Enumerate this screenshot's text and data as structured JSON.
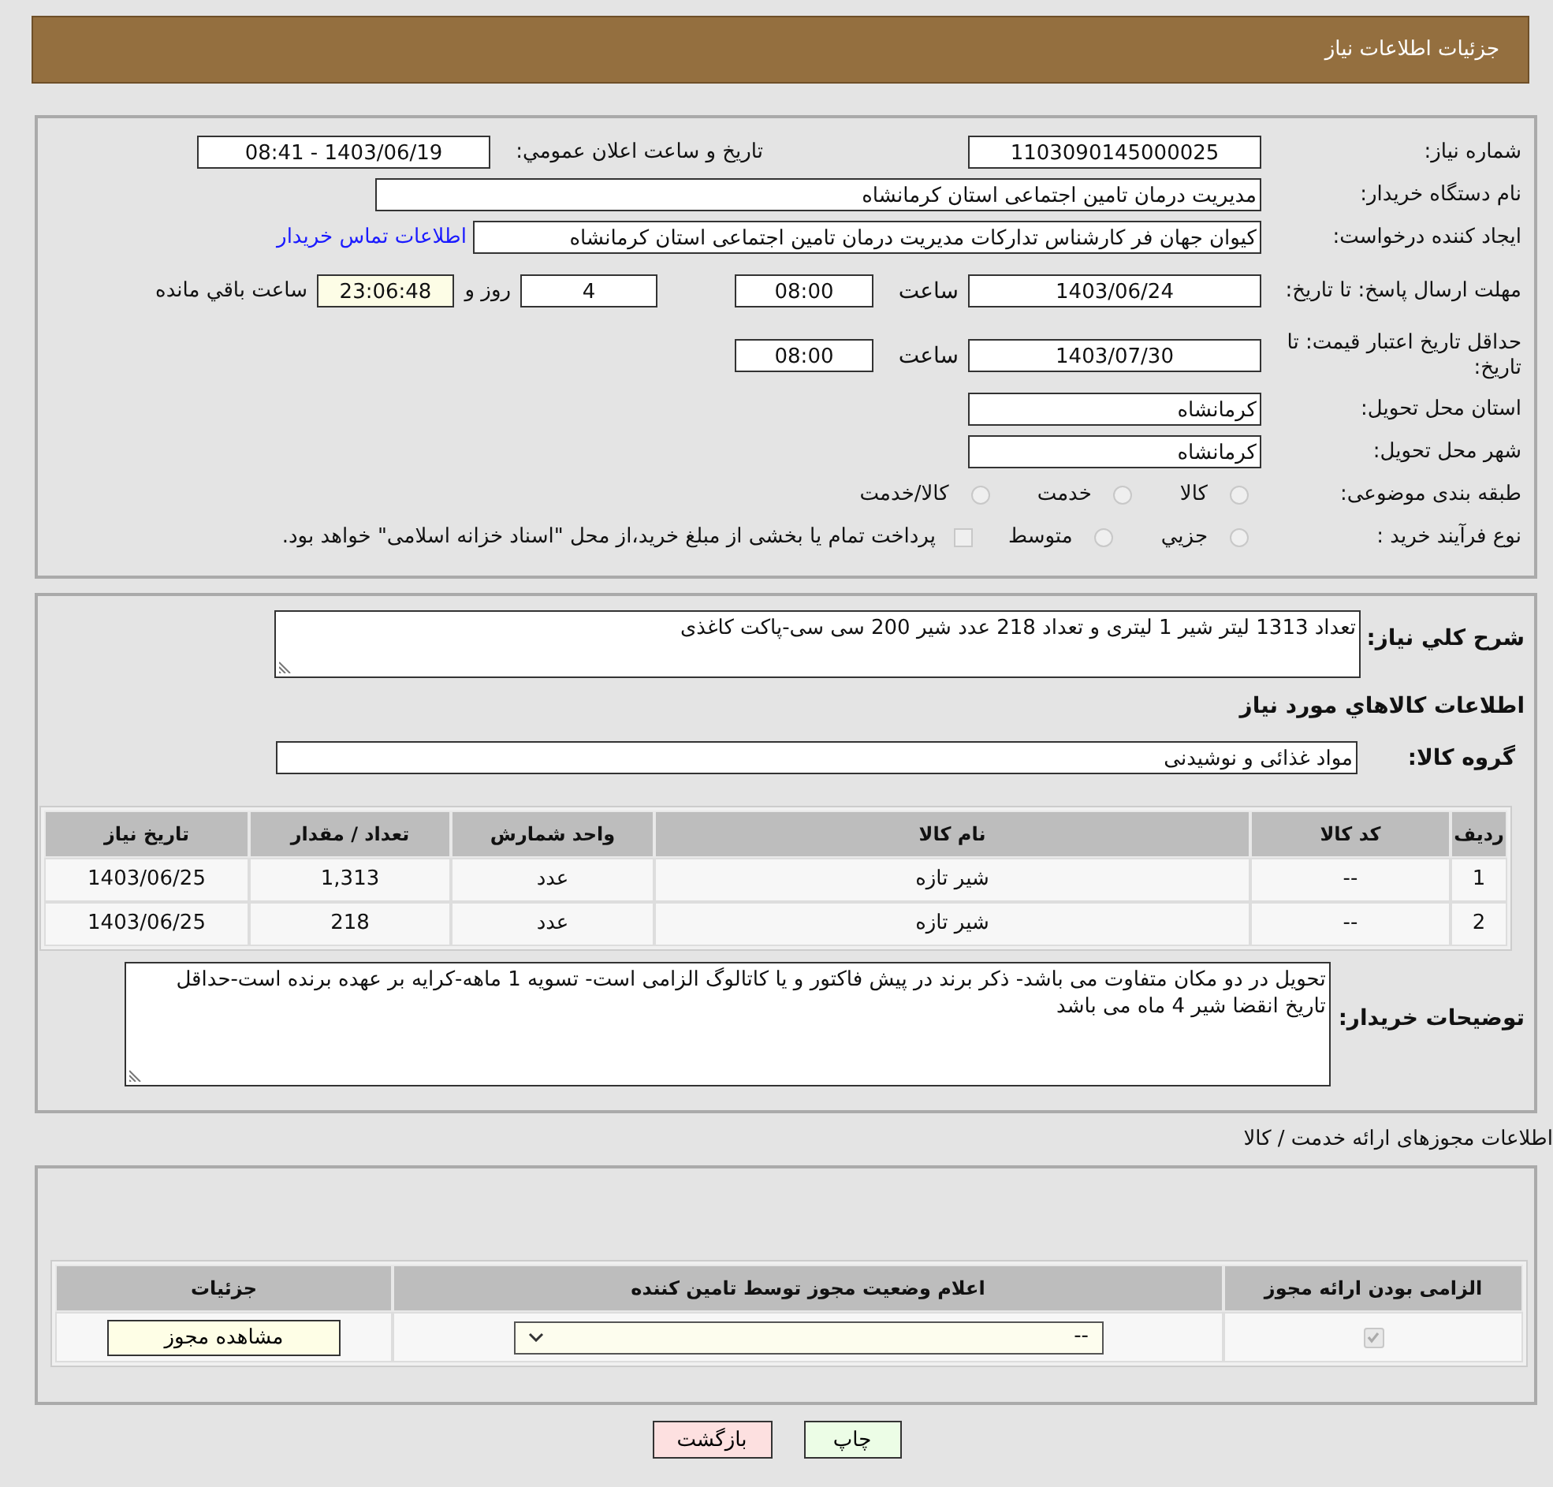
{
  "header": {
    "title": "جزئیات اطلاعات نیاز"
  },
  "need": {
    "number": {
      "label": "شماره نیاز:",
      "value": "1103090145000025"
    },
    "announce": {
      "label": "تاریخ و ساعت اعلان عمومي:",
      "value": "1403/06/19 - 08:41"
    },
    "buyer_org": {
      "label": "نام دستگاه خریدار:",
      "value": "مدیریت درمان تامین اجتماعی استان کرمانشاه"
    },
    "requester": {
      "label": "ایجاد کننده درخواست:",
      "value": "کیوان جهان فر کارشناس تدارکات مدیریت درمان تامین اجتماعی استان کرمانشاه",
      "link": "اطلاعات تماس خریدار"
    },
    "deadline": {
      "label": "مهلت ارسال پاسخ: تا تاریخ:",
      "date": "1403/06/24",
      "time_label": "ساعت",
      "time": "08:00",
      "days": "4",
      "days_label": "روز و",
      "remaining": "23:06:48",
      "remaining_label": "ساعت باقي مانده"
    },
    "price_validity": {
      "label": "حداقل تاریخ اعتبار قیمت: تا تاریخ:",
      "date": "1403/07/30",
      "time_label": "ساعت",
      "time": "08:00"
    },
    "province": {
      "label": "استان محل تحویل:",
      "value": "کرمانشاه"
    },
    "city": {
      "label": "شهر محل تحویل:",
      "value": "کرمانشاه"
    },
    "category": {
      "label": "طبقه بندی موضوعی:",
      "options": [
        {
          "label": "کالا",
          "selected": false
        },
        {
          "label": "خدمت",
          "selected": false
        },
        {
          "label": "کالا/خدمت",
          "selected": false
        }
      ]
    },
    "purchase_type": {
      "label": "نوع فرآیند خرید :",
      "options": [
        {
          "kind": "radio",
          "label": "جزيي",
          "selected": false
        },
        {
          "kind": "radio",
          "label": "متوسط",
          "selected": false
        },
        {
          "kind": "checkbox",
          "label": "پرداخت تمام یا بخشی از مبلغ خرید،از محل \"اسناد خزانه اسلامی\" خواهد بود.",
          "checked": false
        }
      ]
    }
  },
  "goods": {
    "description": {
      "label": "شرح کلي نیاز:",
      "value": "تعداد 1313 لیتر شیر 1 لیتری و تعداد 218 عدد شیر 200 سی سی-پاکت کاغذی"
    },
    "heading": "اطلاعات کالاهاي مورد نیاز",
    "group": {
      "label": "گروه کالا:",
      "value": "مواد غذائی و نوشیدنی"
    },
    "table": {
      "columns": [
        "ردیف",
        "کد کالا",
        "نام کالا",
        "واحد شمارش",
        "تعداد / مقدار",
        "تاریخ نیاز"
      ],
      "rows": [
        [
          "1",
          "--",
          "شیر تازه",
          "عدد",
          "1,313",
          "1403/06/25"
        ],
        [
          "2",
          "--",
          "شیر تازه",
          "عدد",
          "218",
          "1403/06/25"
        ]
      ]
    },
    "notes": {
      "label": "توضیحات خریدار:",
      "value": "تحویل در دو مکان متفاوت می باشد- ذکر برند در پیش فاکتور و یا کاتالوگ الزامی است- تسویه 1 ماهه-کرایه بر عهده برنده است-حداقل تاریخ انقضا شیر 4 ماه می باشد"
    }
  },
  "permits": {
    "title": "اطلاعات مجوزهای ارائه خدمت / کالا",
    "columns": [
      "الزامی بودن ارائه مجوز",
      "اعلام وضعیت مجوز توسط تامین کننده",
      "جزئیات"
    ],
    "rows": [
      {
        "required": true,
        "status": "--",
        "details": "مشاهده مجوز"
      }
    ]
  },
  "buttons": [
    {
      "kind": "print",
      "label": "چاپ"
    },
    {
      "kind": "back",
      "label": "بازگشت"
    }
  ]
}
